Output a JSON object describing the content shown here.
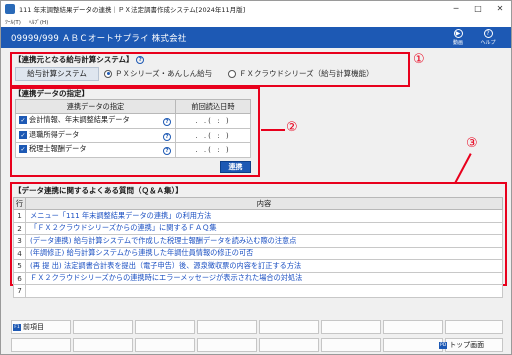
{
  "window": {
    "title": "111 年末調整結果データの連携｜ＰＸ法定調書作成システム[2024年11月版]",
    "controls": [
      "─",
      "□",
      "✕"
    ]
  },
  "menu": [
    "ﾂｰﾙ(T)",
    "ﾍﾙﾌﾟ(H)"
  ],
  "header": {
    "company": "09999/999  ＡＢＣオートサプライ  株式会社",
    "video_label": "動画",
    "help_label": "ヘルプ"
  },
  "annotations": [
    "①",
    "②",
    "③"
  ],
  "section1": {
    "title": "【連携元となる給与計算システム】",
    "system_label": "給与計算システム",
    "options": [
      {
        "label": "ＰＸシリーズ・あんしん給与",
        "selected": true
      },
      {
        "label": "ＦＸクラウドシリーズ（給与計算機能）",
        "selected": false
      }
    ]
  },
  "section2": {
    "title": "【連携データの指定】",
    "col_data": "連携データの指定",
    "col_date": "前回読込日時",
    "rows": [
      {
        "label": "会計情報、年末調整結果データ",
        "date": ". .(  :  )"
      },
      {
        "label": "退職所得データ",
        "date": ". .(  :  )"
      },
      {
        "label": "税理士報酬データ",
        "date": ". .(  :  )"
      }
    ],
    "sync_button": "連携"
  },
  "section3": {
    "title": "【データ連携に関するよくある質問（Ｑ＆Ａ集）】",
    "col_row": "行",
    "col_content": "内容",
    "rows": [
      {
        "num": "1",
        "text": "メニュー「111 年末調整結果データの連携」の利用方法"
      },
      {
        "num": "2",
        "text": "「ＦＸ２クラウドシリーズからの連携」に関するＦＡＱ集"
      },
      {
        "num": "3",
        "text": "(データ連携) 給与計算システムで作成した税理士報酬データを読み込む際の注意点"
      },
      {
        "num": "4",
        "text": "(年調修正) 給与計算システムから連携した年調仕員情報の修正の可否"
      },
      {
        "num": "5",
        "text": "(再 提 出) 法定調書合計表を提出（電子申告）後、源泉徴収票の内容を訂正する方法"
      },
      {
        "num": "6",
        "text": "ＦＸ２クラウドシリーズからの連携時にエラーメッセージが表示された場合の対処法"
      },
      {
        "num": "7",
        "text": ""
      }
    ]
  },
  "footer": {
    "prev_key": "F1",
    "prev_label": "前項目",
    "top_key": "PD",
    "top_label": "トップ画面"
  },
  "colors": {
    "brand_blue": "#1d59b4",
    "annotation_red": "#e8001c",
    "link_blue": "#1a4fc2"
  }
}
